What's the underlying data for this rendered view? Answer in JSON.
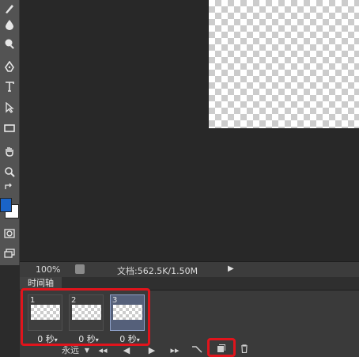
{
  "status_bar": {
    "zoom": "100%",
    "doc_info": "文档:562.5K/1.50M"
  },
  "timeline": {
    "tab_label": "时间轴",
    "frames": [
      {
        "number": "1",
        "delay": "0 秒"
      },
      {
        "number": "2",
        "delay": "0 秒"
      },
      {
        "number": "3",
        "delay": "0 秒",
        "selected": true
      }
    ],
    "loop_label": "永远"
  },
  "colors": {
    "foreground": "#1a64c8",
    "background": "#ffffff",
    "annotation": "#e0141c"
  },
  "icons": [
    "blur-icon",
    "dodge-icon",
    "pen-icon",
    "type-icon",
    "path-select-icon",
    "rectangle-icon",
    "hand-icon",
    "zoom-icon",
    "swap-colors-icon",
    "quick-mask-icon",
    "screen-mode-icon",
    "first-frame-icon",
    "previous-frame-icon",
    "play-icon",
    "next-frame-icon",
    "tween-icon",
    "duplicate-frame-icon",
    "delete-frame-icon"
  ]
}
